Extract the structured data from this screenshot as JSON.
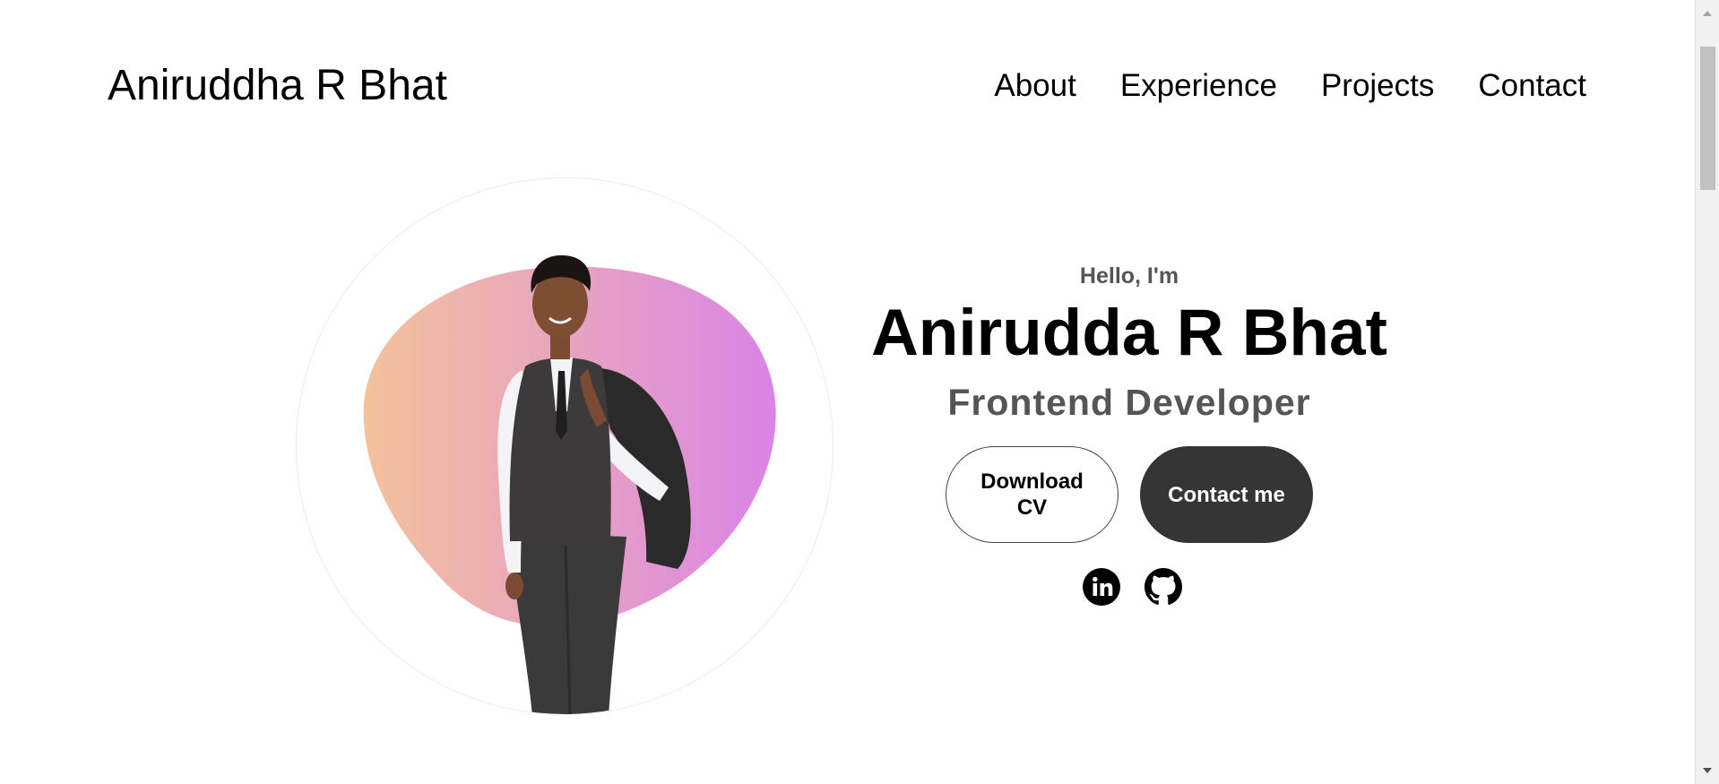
{
  "nav": {
    "logo": "Aniruddha R Bhat",
    "links": [
      {
        "label": "About"
      },
      {
        "label": "Experience"
      },
      {
        "label": "Projects"
      },
      {
        "label": "Contact"
      }
    ]
  },
  "hero": {
    "greeting": "Hello, I'm",
    "name": "Anirudda R Bhat",
    "role": "Frontend Developer",
    "buttons": {
      "download_cv": "Download CV",
      "contact_me": "Contact me"
    },
    "social": [
      {
        "icon": "linkedin-icon"
      },
      {
        "icon": "github-icon"
      }
    ]
  },
  "colors": {
    "blob_gradient_start": "#f4c29c",
    "blob_gradient_end": "#da84e6",
    "primary_button": "#353535",
    "muted_text": "#555555"
  }
}
